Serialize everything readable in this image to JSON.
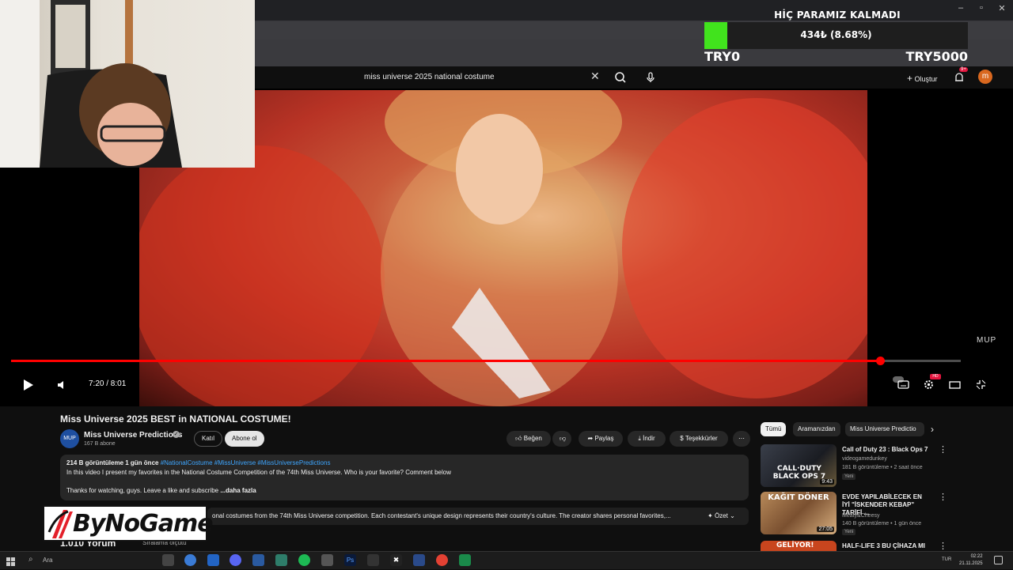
{
  "donation": {
    "title": "HİÇ PARAMIZ KALMADI",
    "amount": "434₺ (8.68%)",
    "progress_fraction": 0.0868,
    "min_label": "TRY0",
    "max_label": "TRY5000",
    "fill_color": "#41e31d"
  },
  "header": {
    "search_value": "miss universe 2025 national costume",
    "create_label": "Oluştur",
    "notification_count": "9+",
    "avatar_letter": "m"
  },
  "player": {
    "watermark": "MUP",
    "time": "7:20 / 8:01",
    "progress_fraction": 0.9148
  },
  "video": {
    "title": "Miss Universe 2025 BEST in NATIONAL COSTUME!",
    "channel_name": "Miss Universe Predictions",
    "channel_avatar_text": "MUP",
    "subscribers": "167 B abone",
    "join_label": "Katıl",
    "subscribe_label": "Abone ol",
    "like_label": "Beğen",
    "share_label": "Paylaş",
    "download_label": "İndir",
    "thanks_label": "Teşekkürler"
  },
  "description": {
    "views_date": "214 B görüntüleme  1 gün önce",
    "tags": "#NationalCostume #MissUniverse #MissUniversePredictions",
    "line1": "In this video I present my favorites in the National Costume Competition of the 74th Miss Universe. Who is your favorite? Comment below",
    "line2": "Thanks for watching, guys. Leave a like and subscribe",
    "more": "...daha fazla"
  },
  "summary": {
    "text": "onal costumes from the 74th Miss Universe competition. Each contestant's unique design represents their country's culture. The creator shares personal favorites,...",
    "toggle_label": "Özet"
  },
  "comments": {
    "count": "1.010 Yorum",
    "sort_label": "Sıralama ölçütü"
  },
  "logo": {
    "text": "ByNoGame"
  },
  "chips": [
    "Tümü",
    "Aramanızdan",
    "Miss Universe Predictio"
  ],
  "recommendations": [
    {
      "title": "Call of Duty 23 : Black Ops 7",
      "channel": "videogamedunkey",
      "stats": "181 B görüntüleme • 2 saat önce",
      "badge": "Yeni",
      "duration": "9:43",
      "thumb_text": "CALL·DUTY BLACK OPS 7"
    },
    {
      "title": "EVDE YAPILABİLECEK EN İYİ \"İSKENDER KEBAP\" TARİFİ ...",
      "channel": "Meaty&Cheesy",
      "stats": "140 B görüntüleme • 1 gün önce",
      "badge": "Yeni",
      "duration": "27:05",
      "thumb_text": "KAĞIT DÖNER"
    },
    {
      "title": "HALF-LIFE 3 BU ÇİHAZA MI",
      "channel": "",
      "stats": "",
      "badge": "",
      "duration": "",
      "thumb_text": "GELİYOR!"
    }
  ],
  "taskbar": {
    "search_placeholder": "Ara",
    "lang": "TUR",
    "time": "02:22",
    "date": "21.11.2025"
  }
}
